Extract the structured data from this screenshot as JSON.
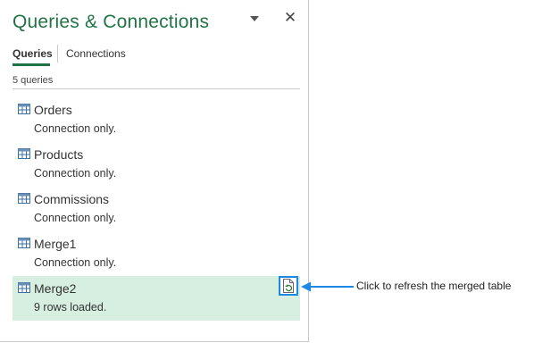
{
  "pane": {
    "title": "Queries & Connections",
    "tabs": {
      "queries": "Queries",
      "connections": "Connections"
    },
    "count": "5 queries",
    "queries": [
      {
        "name": "Orders",
        "status": "Connection only."
      },
      {
        "name": "Products",
        "status": "Connection only."
      },
      {
        "name": "Commissions",
        "status": "Connection only."
      },
      {
        "name": "Merge1",
        "status": "Connection only."
      },
      {
        "name": "Merge2",
        "status": "9 rows loaded."
      }
    ]
  },
  "callout": {
    "text": "Click to refresh the merged table"
  },
  "colors": {
    "accent": "#217346",
    "selected_bg": "#d6efe0",
    "callout_blue": "#1e88e5"
  },
  "icons": {
    "query": "table-icon",
    "refresh": "refresh-icon",
    "close": "close-icon",
    "menu": "chevron-down-icon"
  }
}
